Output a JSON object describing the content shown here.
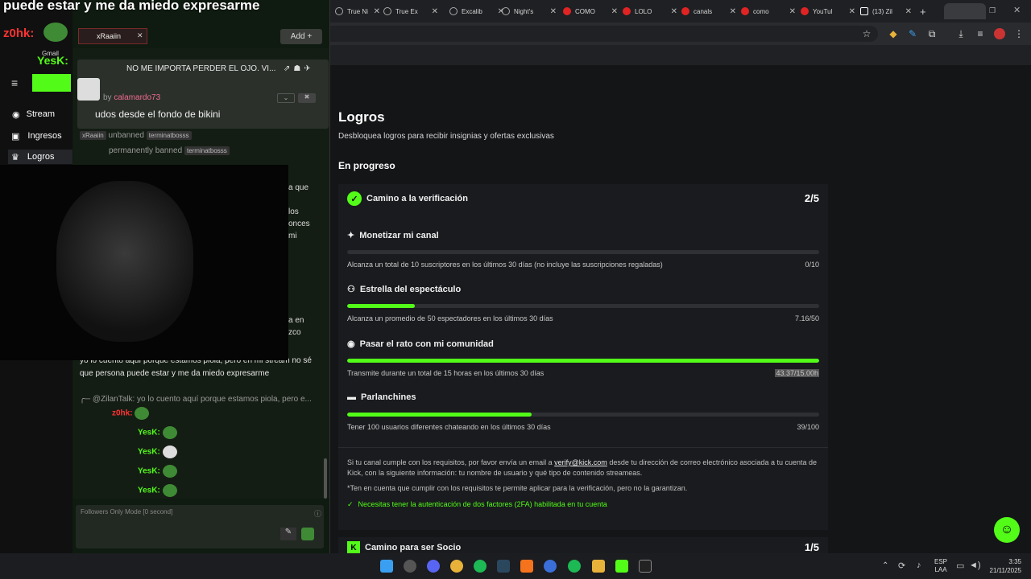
{
  "overlay_title": "puede estar y me da miedo expresarme",
  "browser": {
    "tabs": [
      {
        "label": "True Ni",
        "icon": "globe-icon"
      },
      {
        "label": "True Ex",
        "icon": "globe-icon"
      },
      {
        "label": "Excalib",
        "icon": "globe-icon"
      },
      {
        "label": "Night's",
        "icon": "globe-icon"
      },
      {
        "label": "COMO",
        "icon": "youtube-icon"
      },
      {
        "label": "LOLO",
        "icon": "youtube-icon"
      },
      {
        "label": "canals",
        "icon": "youtube-icon"
      },
      {
        "label": "como",
        "icon": "youtube-icon"
      },
      {
        "label": "YouTul",
        "icon": "youtube-icon"
      },
      {
        "label": "(13) Zil",
        "icon": "x-icon"
      }
    ]
  },
  "left_overlay": {
    "user1": "z0hk:",
    "user2": "YesK:",
    "gmail": "Gmail",
    "nav": [
      "Stream",
      "Ingresos",
      "Logros"
    ]
  },
  "chat": {
    "pinned_user": "xRaaiin",
    "add_label": "Add",
    "pinned_message": "NO ME IMPORTA PERDER EL OJO. VI...",
    "pin_by": "by",
    "pin_author": "calamardo73",
    "pin_text": "udos desde el fondo de bikini",
    "event1_user": "xRaaiin",
    "event1_action": "unbanned",
    "event1_target": "terminatbosss",
    "event2_action": "permanently banned",
    "event2_target": "terminatbosss",
    "frag1": "a que",
    "frag2": "los",
    "frag3": "onces",
    "frag4": "mi",
    "frag5": "a en",
    "frag6": "zco",
    "msg_main": "yo lo cuento aquí porque estamos piola, pero en mi stream no sé que persona puede estar y me da miedo expresarme",
    "reply_ref": "@ZilanTalk: yo lo cuento aquí porque estamos piola, pero e...",
    "z0hk": "z0hk:",
    "yesk": "YesK:",
    "input_placeholder": "Followers Only Mode [0 second]"
  },
  "kick": {
    "title": "Logros",
    "subtitle": "Desbloquea logros para recibir insignias y ofertas exclusivas",
    "section": "En progreso",
    "path1_title": "Camino a la verificación",
    "path1_progress": "2/5",
    "items": [
      {
        "title": "Monetizar mi canal",
        "desc": "Alcanza un total de 10 suscriptores en los últimos 30 días (no incluye las suscripciones regaladas)",
        "value": "0/10",
        "fraction": 0.0
      },
      {
        "title": "Estrella del espectáculo",
        "desc": "Alcanza un promedio de 50 espectadores en los últimos 30 días",
        "value": "7.16/50",
        "fraction": 0.143
      },
      {
        "title": "Pasar el rato con mi comunidad",
        "desc": "Transmite durante un total de 15 horas en los últimos 30 días",
        "value": "43.37/15.00h",
        "fraction": 1.0
      },
      {
        "title": "Parlanchines",
        "desc": "Tener 100 usuarios diferentes chateando en los últimos 30 días",
        "value": "39/100",
        "fraction": 0.39
      }
    ],
    "note_pre": "Si tu canal cumple con los requisitos, por favor envía un email a",
    "note_email": "verify@kick.com",
    "note_post": "desde tu dirección de correo electrónico asociada a tu cuenta de Kick, con la siguiente información: tu nombre de usuario y qué tipo de contenido streameas.",
    "note2": "*Ten en cuenta que cumplir con los requisitos te permite aplicar para la verificación, pero no la garantizan.",
    "twofa": "Necesitas tener la autenticación de dos factores (2FA) habilitada en tu cuenta",
    "path2_title": "Camino para ser Socio",
    "path2_progress": "1/5"
  },
  "taskbar": {
    "lang1": "ESP",
    "lang2": "LAA",
    "time": "3:35",
    "date": "21/11/2025"
  },
  "colors": {
    "accent": "#53fc18",
    "bg": "#141517",
    "card": "#191b1e"
  }
}
